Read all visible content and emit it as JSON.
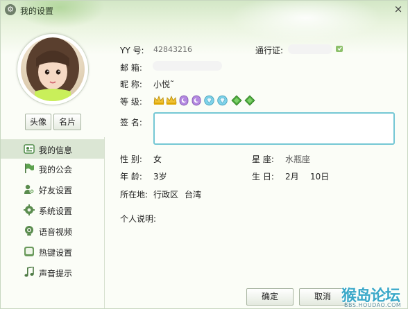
{
  "window": {
    "title": "我的设置",
    "close_symbol": "×"
  },
  "profile": {
    "avatar_button": "头像",
    "card_button": "名片"
  },
  "sidebar": {
    "items": [
      {
        "label": "我的信息",
        "icon": "my-info-icon",
        "active": true
      },
      {
        "label": "我的公会",
        "icon": "guild-flag-icon",
        "active": false
      },
      {
        "label": "好友设置",
        "icon": "friend-settings-icon",
        "active": false
      },
      {
        "label": "系统设置",
        "icon": "system-gear-icon",
        "active": false
      },
      {
        "label": "语音视频",
        "icon": "voice-video-icon",
        "active": false
      },
      {
        "label": "热键设置",
        "icon": "hotkey-icon",
        "active": false
      },
      {
        "label": "声音提示",
        "icon": "sound-note-icon",
        "active": false
      }
    ]
  },
  "info": {
    "yy_label": "YY  号:",
    "yy_value": "42843216",
    "passport_label": "通行证:",
    "email_label": "邮  箱:",
    "nickname_label": "昵  称:",
    "nickname_value": "小悦˜",
    "level_label": "等  级:",
    "level_icons": [
      "crown-icon",
      "crown-icon",
      "moon-icon",
      "moon-icon",
      "diamond-icon",
      "diamond-icon",
      "sun-icon",
      "sun-icon"
    ],
    "signature_label": "签  名:",
    "gender_label": "性  别:",
    "gender_value": "女",
    "constellation_label": "星  座:",
    "constellation_value": "水瓶座",
    "age_label": "年  龄:",
    "age_value": "3岁",
    "birthday_label": "生  日:",
    "birthday_month": "2月",
    "birthday_day": "10日",
    "location_label": "所在地:",
    "location_value1": "行政区",
    "location_value2": "台湾",
    "description_label": "个人说明:"
  },
  "footer": {
    "ok_label": "确定",
    "cancel_label": "取消"
  },
  "watermark": {
    "main": "猴岛论坛",
    "sub": "BBS.HOUDAO.COM"
  },
  "colors": {
    "accent_green": "#dbe6d4",
    "signature_border": "#74c7d4",
    "watermark": "#3aa8c8"
  }
}
